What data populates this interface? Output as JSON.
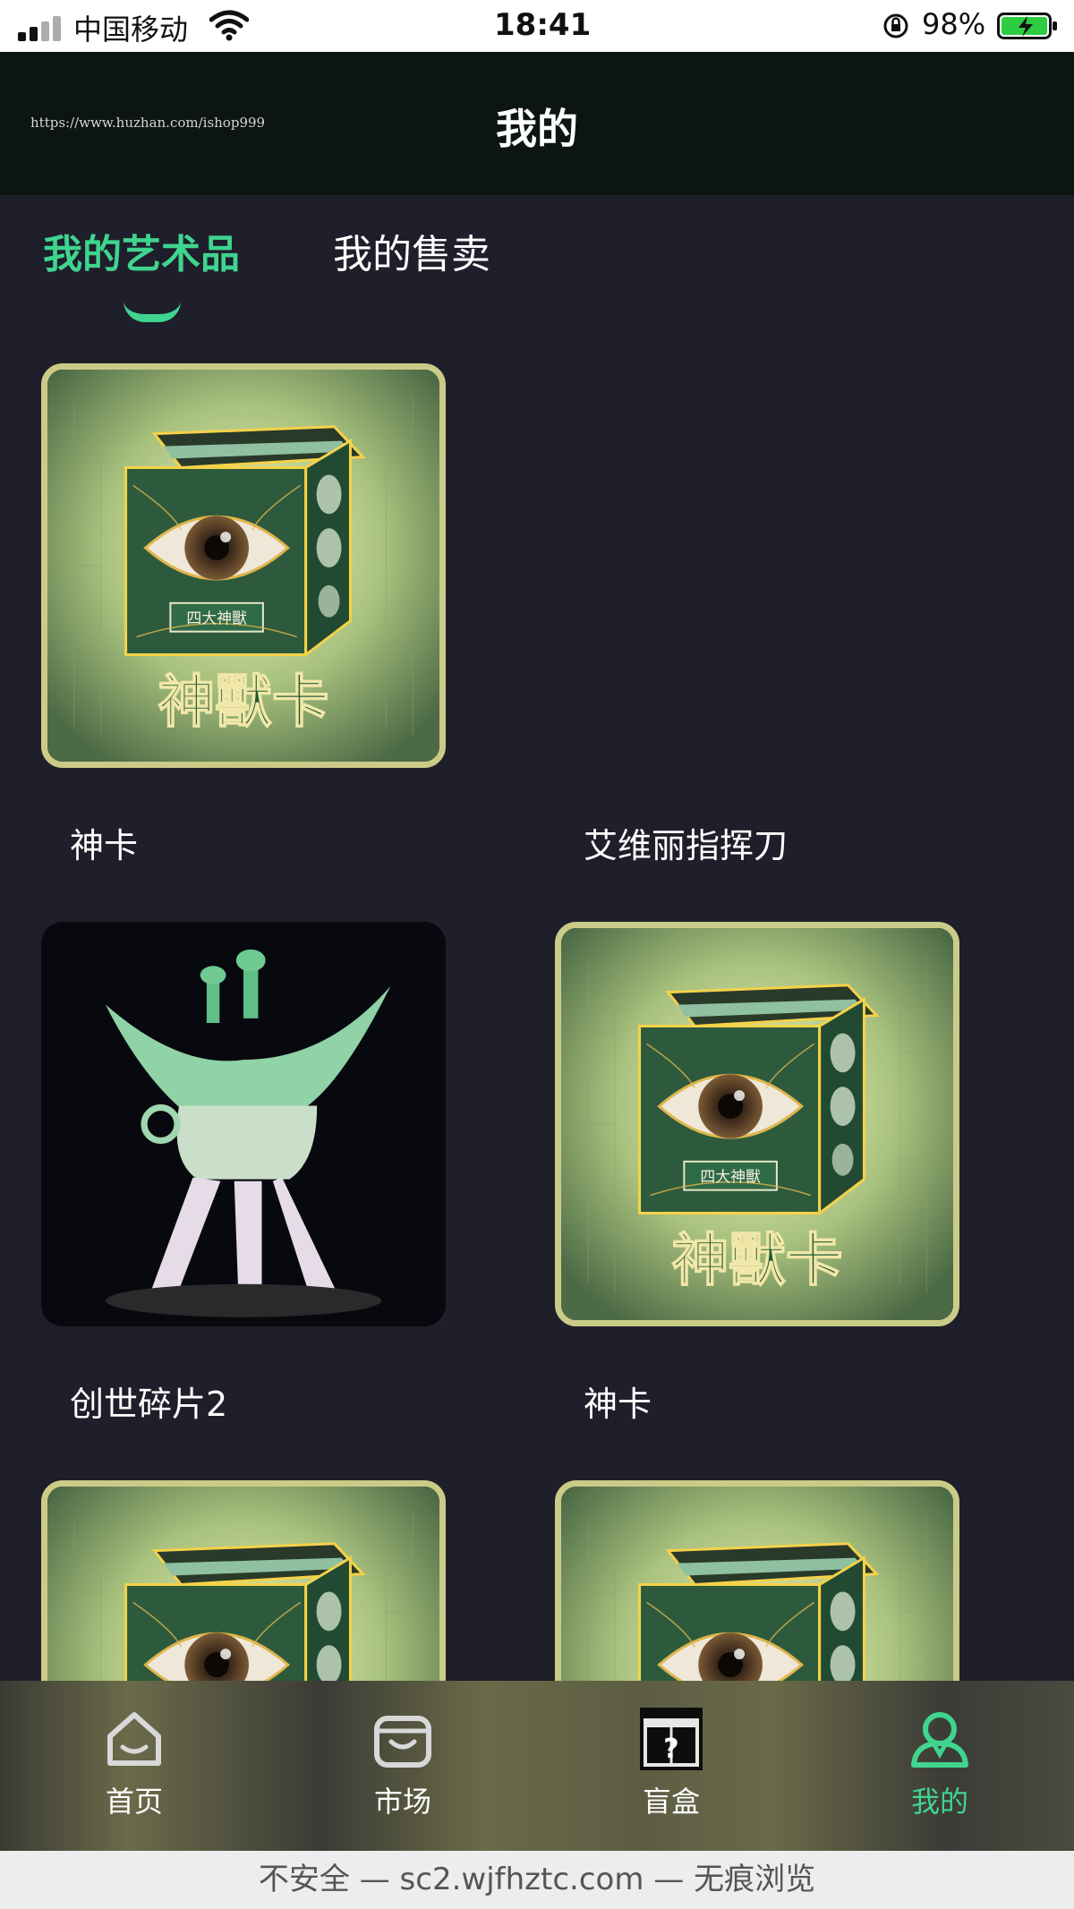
{
  "status_bar": {
    "carrier": "中国移动",
    "time": "18:41",
    "battery": "98%"
  },
  "header": {
    "watermark": "https://www.huzhan.com/ishop999",
    "title": "我的"
  },
  "tabs": [
    {
      "label": "我的艺术品",
      "active": true
    },
    {
      "label": "我的售卖",
      "active": false
    }
  ],
  "accent_color": "#3fd58f",
  "cards": [
    {
      "title": "神卡",
      "image": "divine-beast-card"
    },
    {
      "title": "艾维丽指挥刀",
      "image": ""
    },
    {
      "title": "创世碎片2",
      "image": "jade-vessel"
    },
    {
      "title": "神卡",
      "image": "divine-beast-card"
    },
    {
      "title": "",
      "image": "divine-beast-card"
    },
    {
      "title": "",
      "image": "divine-beast-card"
    }
  ],
  "card_art": {
    "box_label": "四大神獸",
    "caption": "神獸卡"
  },
  "nav": [
    {
      "label": "首页",
      "icon": "home-icon"
    },
    {
      "label": "市场",
      "icon": "shopping-bag-icon"
    },
    {
      "label": "盲盒",
      "icon": "mystery-box-icon"
    },
    {
      "label": "我的",
      "icon": "user-icon",
      "active": true
    }
  ],
  "browser_bar": {
    "text": "不安全 — sc2.wjfhztc.com — 无痕浏览"
  }
}
